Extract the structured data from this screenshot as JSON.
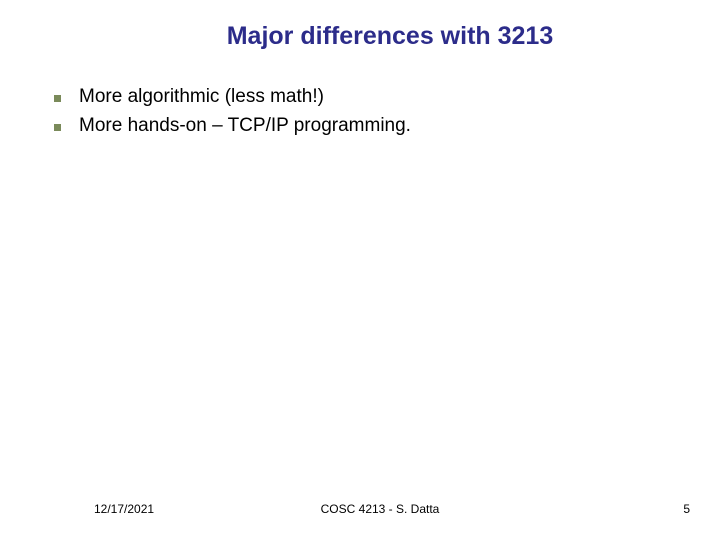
{
  "title": "Major differences with 3213",
  "bullets": [
    "More algorithmic (less math!)",
    "More hands-on – TCP/IP programming."
  ],
  "footer": {
    "date": "12/17/2021",
    "center": "COSC 4213 - S. Datta",
    "page": "5"
  }
}
